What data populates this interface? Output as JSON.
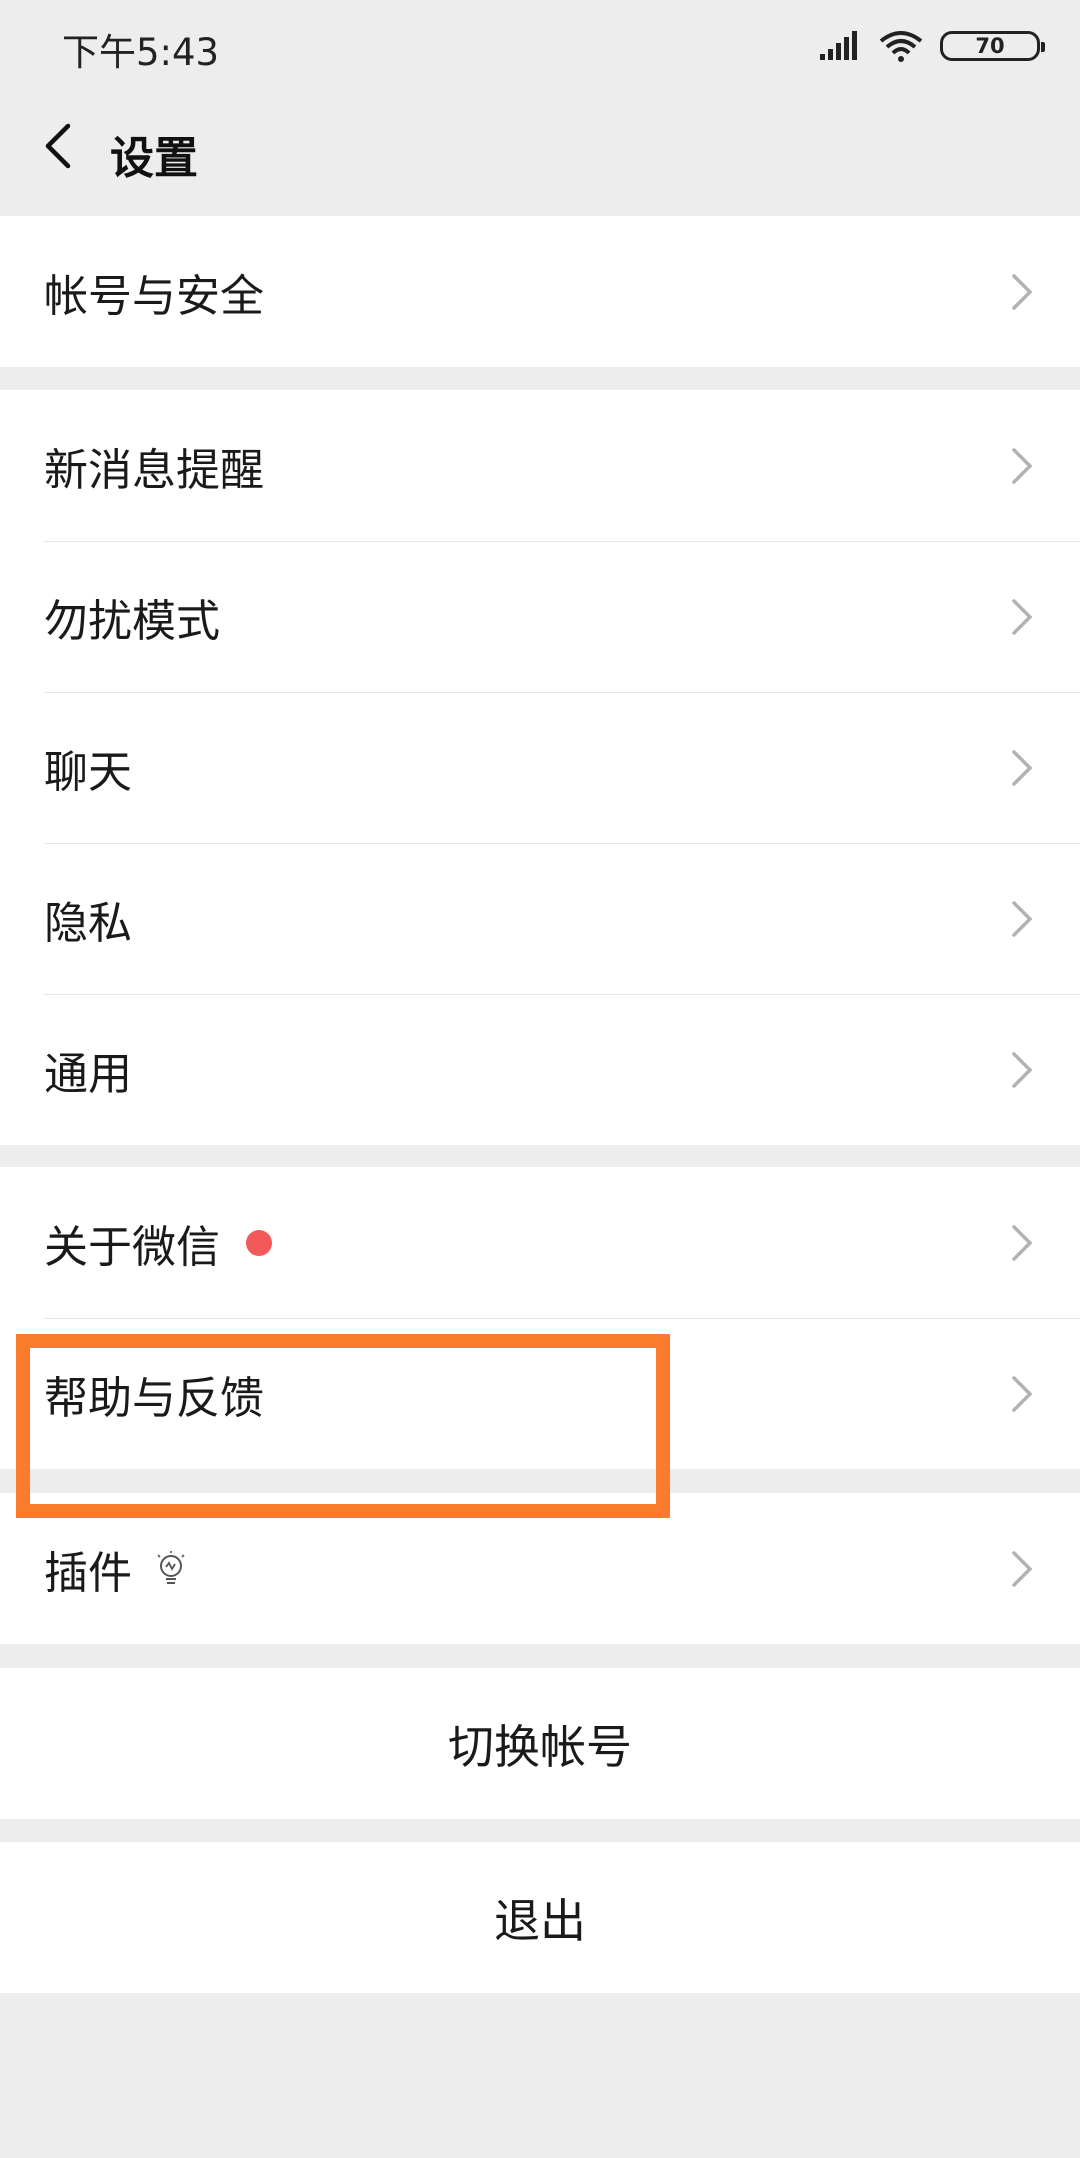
{
  "status_bar": {
    "time": "下午5:43",
    "battery": "70"
  },
  "nav": {
    "title": "设置"
  },
  "sections": {
    "account": [
      "帐号与安全"
    ],
    "main": [
      "新消息提醒",
      "勿扰模式",
      "聊天",
      "隐私",
      "通用"
    ],
    "about": [
      "关于微信",
      "帮助与反馈"
    ],
    "plugins": [
      "插件"
    ]
  },
  "actions": {
    "switch_account": "切换帐号",
    "logout": "退出"
  },
  "colors": {
    "background": "#ededed",
    "highlight": "#fb7b2c",
    "badge": "#f25a5a"
  }
}
